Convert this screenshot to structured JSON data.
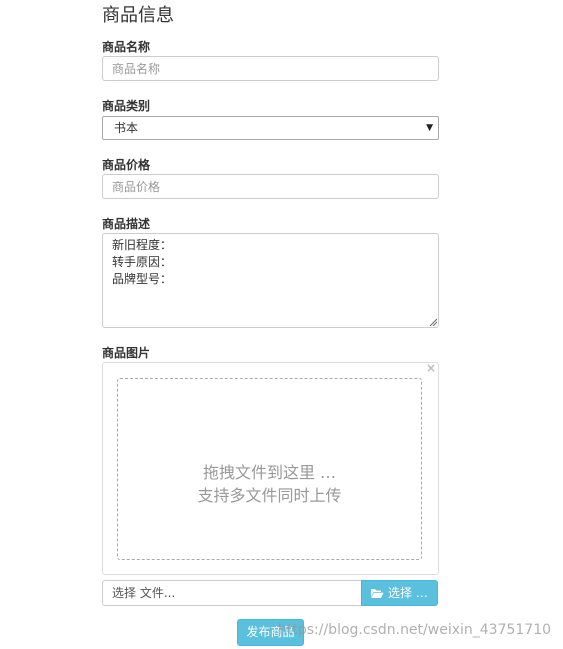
{
  "form": {
    "title": "商品信息",
    "name_label": "商品名称",
    "name_placeholder": "商品名称",
    "category_label": "商品类别",
    "category_selected": "书本",
    "price_label": "商品价格",
    "price_placeholder": "商品价格",
    "description_label": "商品描述",
    "description_lines": [
      "新旧程度：",
      "转手原因：",
      "品牌型号："
    ],
    "image_label": "商品图片",
    "upload": {
      "close_glyph": "×",
      "drop_line1": "拖拽文件到这里 …",
      "drop_line2": "支持多文件同时上传",
      "caption_placeholder": "选择 文件...",
      "browse_label": "选择 …",
      "browse_icon": "folder-open-icon"
    },
    "submit_label": "发布商品"
  },
  "watermark": "https://blog.csdn.net/weixin_43751710",
  "colors": {
    "accent": "#5bc0de",
    "border": "#cccccc",
    "placeholder": "#999999"
  }
}
